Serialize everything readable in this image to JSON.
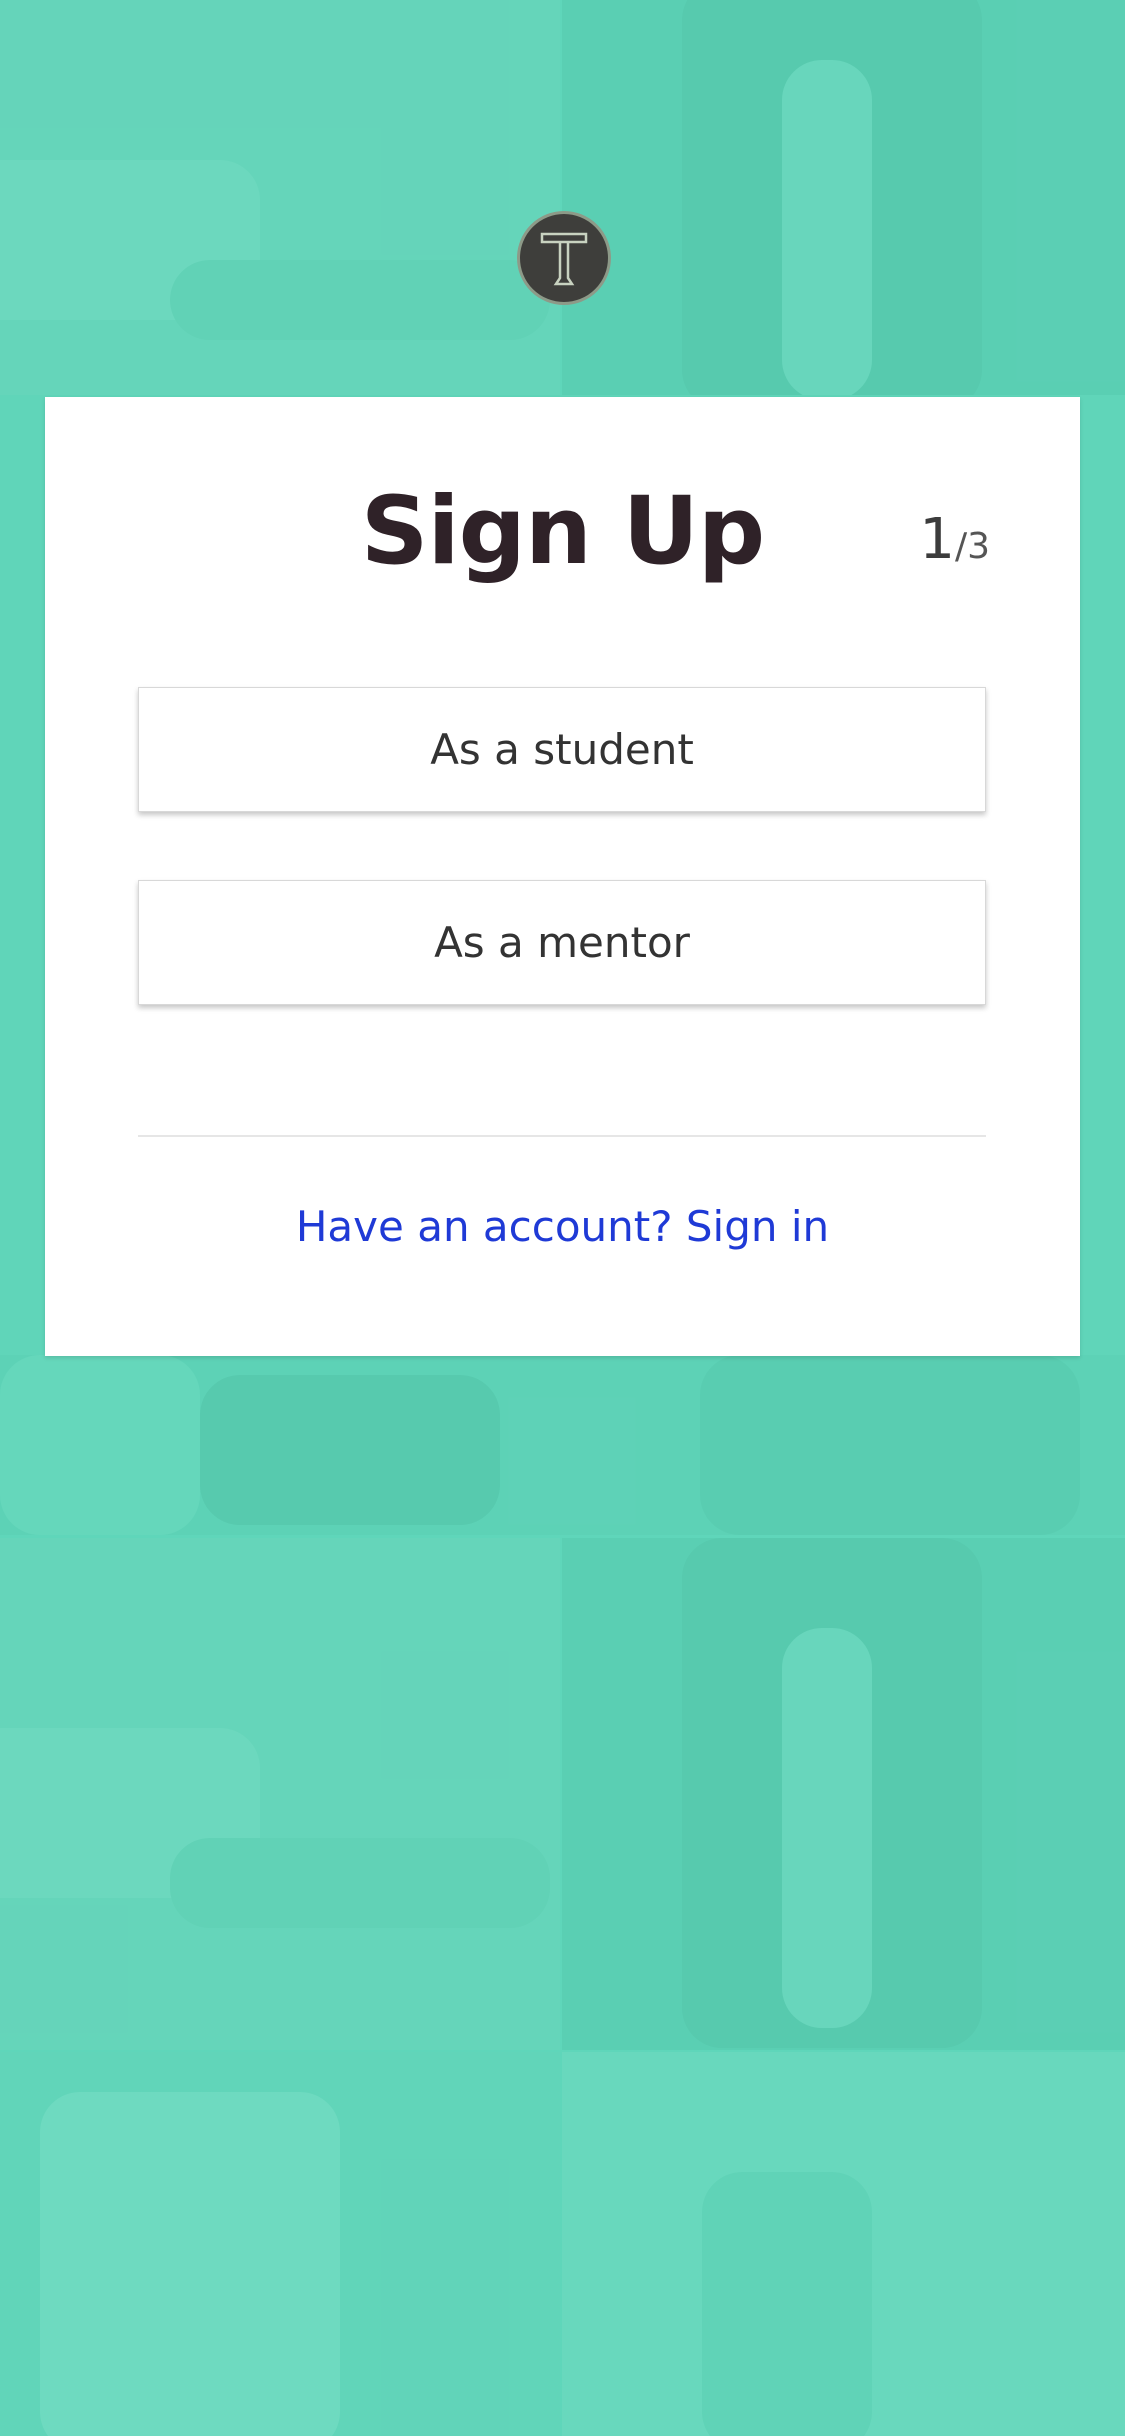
{
  "logo": {
    "icon": "t-logo-icon",
    "letter": "T"
  },
  "signup": {
    "title": "Sign Up",
    "step_current": "1",
    "step_total": "/3",
    "options": [
      {
        "label": "As a student"
      },
      {
        "label": "As a mentor"
      }
    ],
    "signin_link": "Have an account? Sign in"
  },
  "colors": {
    "background_tint": "#5ed6b9",
    "title": "#2f2228",
    "link": "#1f3ad6",
    "logo_bg": "#3e3e3b"
  }
}
